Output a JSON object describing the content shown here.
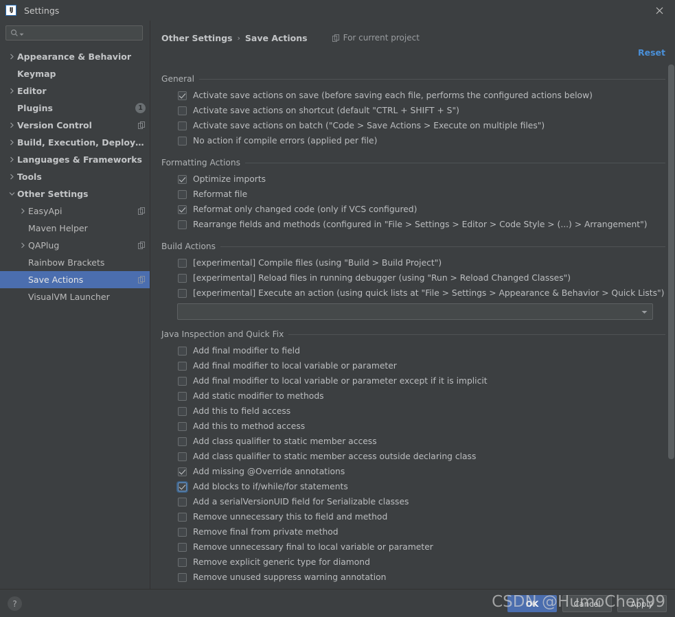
{
  "window": {
    "title": "Settings",
    "logo_text": "IJ",
    "close_icon": "close-icon"
  },
  "sidebar": {
    "search": {
      "placeholder": "",
      "value": "",
      "icon": "search-icon"
    },
    "items": [
      {
        "label": "Appearance & Behavior",
        "arrow": "right",
        "bold": true,
        "indent": 0,
        "badge": null,
        "project_icon": false,
        "selected": false
      },
      {
        "label": "Keymap",
        "arrow": "none",
        "bold": true,
        "indent": 0,
        "badge": null,
        "project_icon": false,
        "selected": false
      },
      {
        "label": "Editor",
        "arrow": "right",
        "bold": true,
        "indent": 0,
        "badge": null,
        "project_icon": false,
        "selected": false
      },
      {
        "label": "Plugins",
        "arrow": "none",
        "bold": true,
        "indent": 0,
        "badge": "1",
        "project_icon": false,
        "selected": false
      },
      {
        "label": "Version Control",
        "arrow": "right",
        "bold": true,
        "indent": 0,
        "badge": null,
        "project_icon": true,
        "selected": false
      },
      {
        "label": "Build, Execution, Deployment",
        "arrow": "right",
        "bold": true,
        "indent": 0,
        "badge": null,
        "project_icon": false,
        "selected": false
      },
      {
        "label": "Languages & Frameworks",
        "arrow": "right",
        "bold": true,
        "indent": 0,
        "badge": null,
        "project_icon": false,
        "selected": false
      },
      {
        "label": "Tools",
        "arrow": "right",
        "bold": true,
        "indent": 0,
        "badge": null,
        "project_icon": false,
        "selected": false
      },
      {
        "label": "Other Settings",
        "arrow": "down",
        "bold": true,
        "indent": 0,
        "badge": null,
        "project_icon": false,
        "selected": false
      },
      {
        "label": "EasyApi",
        "arrow": "right",
        "bold": false,
        "indent": 1,
        "badge": null,
        "project_icon": true,
        "selected": false
      },
      {
        "label": "Maven Helper",
        "arrow": "none",
        "bold": false,
        "indent": 1,
        "badge": null,
        "project_icon": false,
        "selected": false
      },
      {
        "label": "QAPlug",
        "arrow": "right",
        "bold": false,
        "indent": 1,
        "badge": null,
        "project_icon": true,
        "selected": false
      },
      {
        "label": "Rainbow Brackets",
        "arrow": "none",
        "bold": false,
        "indent": 1,
        "badge": null,
        "project_icon": false,
        "selected": false
      },
      {
        "label": "Save Actions",
        "arrow": "none",
        "bold": false,
        "indent": 1,
        "badge": null,
        "project_icon": true,
        "selected": true
      },
      {
        "label": "VisualVM Launcher",
        "arrow": "none",
        "bold": false,
        "indent": 1,
        "badge": null,
        "project_icon": false,
        "selected": false
      }
    ]
  },
  "header": {
    "breadcrumb": [
      "Other Settings",
      "Save Actions"
    ],
    "breadcrumb_separator": "›",
    "for_current_project": "For current project",
    "for_current_project_icon": "project-scope-icon",
    "reset_label": "Reset"
  },
  "sections": [
    {
      "title": "General",
      "options": [
        {
          "label": "Activate save actions on save (before saving each file, performs the configured actions below)",
          "checked": true,
          "focused": false
        },
        {
          "label": "Activate save actions on shortcut (default \"CTRL + SHIFT + S\")",
          "checked": false,
          "focused": false
        },
        {
          "label": "Activate save actions on batch (\"Code > Save Actions > Execute on multiple files\")",
          "checked": false,
          "focused": false
        },
        {
          "label": "No action if compile errors (applied per file)",
          "checked": false,
          "focused": false
        }
      ]
    },
    {
      "title": "Formatting Actions",
      "options": [
        {
          "label": "Optimize imports",
          "checked": true,
          "focused": false
        },
        {
          "label": "Reformat file",
          "checked": false,
          "focused": false
        },
        {
          "label": "Reformat only changed code (only if VCS configured)",
          "checked": true,
          "focused": false
        },
        {
          "label": "Rearrange fields and methods (configured in \"File > Settings > Editor > Code Style > (...) > Arrangement\")",
          "checked": false,
          "focused": false
        }
      ]
    },
    {
      "title": "Build Actions",
      "options": [
        {
          "label": "[experimental] Compile files (using \"Build > Build Project\")",
          "checked": false,
          "focused": false
        },
        {
          "label": "[experimental] Reload files in running debugger (using \"Run > Reload Changed Classes\")",
          "checked": false,
          "focused": false
        },
        {
          "label": "[experimental] Execute an action (using quick lists at \"File > Settings > Appearance & Behavior > Quick Lists\")",
          "checked": false,
          "focused": false
        }
      ],
      "combo": {
        "value": "",
        "icon": "chevron-down-icon"
      }
    },
    {
      "title": "Java Inspection and Quick Fix",
      "options": [
        {
          "label": "Add final modifier to field",
          "checked": false,
          "focused": false
        },
        {
          "label": "Add final modifier to local variable or parameter",
          "checked": false,
          "focused": false
        },
        {
          "label": "Add final modifier to local variable or parameter except if it is implicit",
          "checked": false,
          "focused": false
        },
        {
          "label": "Add static modifier to methods",
          "checked": false,
          "focused": false
        },
        {
          "label": "Add this to field access",
          "checked": false,
          "focused": false
        },
        {
          "label": "Add this to method access",
          "checked": false,
          "focused": false
        },
        {
          "label": "Add class qualifier to static member access",
          "checked": false,
          "focused": false
        },
        {
          "label": "Add class qualifier to static member access outside declaring class",
          "checked": false,
          "focused": false
        },
        {
          "label": "Add missing @Override annotations",
          "checked": true,
          "focused": false
        },
        {
          "label": "Add blocks to if/while/for statements",
          "checked": true,
          "focused": true
        },
        {
          "label": "Add a serialVersionUID field for Serializable classes",
          "checked": false,
          "focused": false
        },
        {
          "label": "Remove unnecessary this to field and method",
          "checked": false,
          "focused": false
        },
        {
          "label": "Remove final from private method",
          "checked": false,
          "focused": false
        },
        {
          "label": "Remove unnecessary final to local variable or parameter",
          "checked": false,
          "focused": false
        },
        {
          "label": "Remove explicit generic type for diamond",
          "checked": false,
          "focused": false
        },
        {
          "label": "Remove unused suppress warning annotation",
          "checked": false,
          "focused": false
        }
      ]
    }
  ],
  "footer": {
    "help_label": "?",
    "buttons": [
      {
        "label": "OK",
        "primary": true
      },
      {
        "label": "Cancel",
        "primary": false
      },
      {
        "label": "Apply",
        "primary": false
      }
    ]
  },
  "watermark": "CSDN @HumoChen99",
  "colors": {
    "background": "#3c3f41",
    "selection": "#4b6eaf",
    "accent_link": "#4a90d9",
    "text": "#bbbbbb",
    "section_rule": "#4f5355"
  }
}
